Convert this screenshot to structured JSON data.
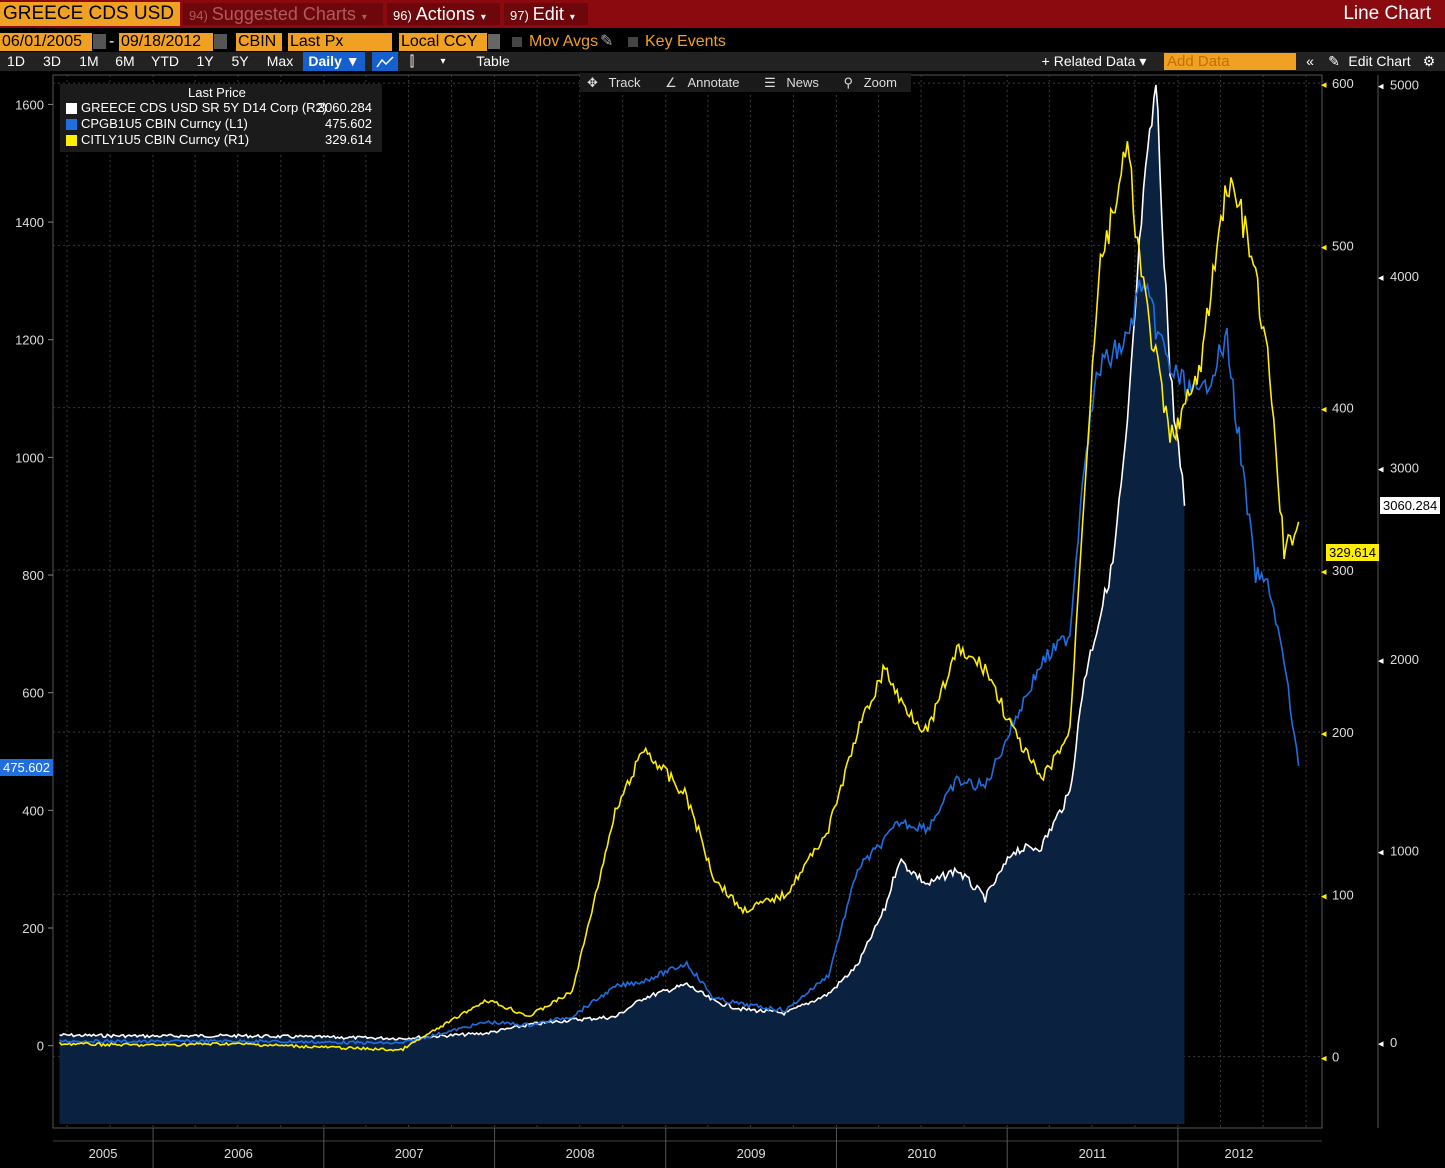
{
  "header": {
    "security": "GREECE CDS USD SR",
    "menus": [
      {
        "num": "94)",
        "label": "Suggested Charts"
      },
      {
        "num": "96)",
        "label": "Actions"
      },
      {
        "num": "97)",
        "label": "Edit"
      }
    ],
    "chart_kind": "Line Chart"
  },
  "controls": {
    "start_date": "06/01/2005",
    "end_date": "09/18/2012",
    "source": "CBIN",
    "field": "Last Px",
    "currency": "Local CCY",
    "mov_avgs": "Mov Avgs",
    "key_events": "Key Events"
  },
  "ranges": {
    "buttons": [
      "1D",
      "3D",
      "1M",
      "6M",
      "YTD",
      "1Y",
      "5Y",
      "Max"
    ],
    "frequency": "Daily ▼",
    "table": "Table",
    "related": "+ Related Data ▾",
    "add_data_placeholder": "Add Data",
    "edit_chart": "Edit Chart"
  },
  "toolbar": {
    "track": "Track",
    "annotate": "Annotate",
    "news": "News",
    "zoom": "Zoom"
  },
  "legend": {
    "title": "Last Price",
    "items": [
      {
        "label": "GREECE CDS USD SR 5Y D14 Corp  (R2)",
        "value": "3060.284",
        "color": "#ffffff"
      },
      {
        "label": "CPGB1U5 CBIN Curncy  (L1)",
        "value": "475.602",
        "color": "#1f6fe0"
      },
      {
        "label": "CITLY1U5 CBIN Curncy  (R1)",
        "value": "329.614",
        "color": "#ffee00"
      }
    ]
  },
  "chart_data": {
    "type": "line",
    "x_start": "2005-06-01",
    "x_end": "2012-09-18",
    "x_ticks": [
      "2005",
      "2006",
      "2007",
      "2008",
      "2009",
      "2010",
      "2011",
      "2012"
    ],
    "axes": {
      "L1": {
        "ticks": [
          "0",
          "200",
          "400",
          "600",
          "800",
          "1000",
          "1200",
          "1400",
          "1600"
        ],
        "range": [
          -140,
          1650
        ]
      },
      "R1": {
        "ticks": [
          "0",
          "100",
          "200",
          "300",
          "400",
          "500",
          "600"
        ],
        "range": [
          -44,
          605
        ]
      },
      "R2": {
        "ticks": [
          "0",
          "1000",
          "2000",
          "3000",
          "4000",
          "5000"
        ],
        "range": [
          -450,
          5050
        ]
      }
    },
    "last_values": {
      "L1": "475.602",
      "R1": "329.614",
      "R2": "3060.284"
    },
    "series": [
      {
        "name": "GREECE CDS USD SR 5Y D14 Corp",
        "axis": "R2",
        "color": "#ffffff",
        "fill": "#0b2140",
        "points": [
          [
            "2005-06",
            35
          ],
          [
            "2005-12",
            30
          ],
          [
            "2006-06",
            32
          ],
          [
            "2006-12",
            25
          ],
          [
            "2007-06",
            18
          ],
          [
            "2007-12",
            45
          ],
          [
            "2008-03",
            90
          ],
          [
            "2008-06",
            115
          ],
          [
            "2008-09",
            130
          ],
          [
            "2008-11",
            230
          ],
          [
            "2009-02",
            300
          ],
          [
            "2009-04",
            210
          ],
          [
            "2009-06",
            170
          ],
          [
            "2009-09",
            150
          ],
          [
            "2009-12",
            250
          ],
          [
            "2010-02",
            400
          ],
          [
            "2010-04",
            700
          ],
          [
            "2010-05",
            950
          ],
          [
            "2010-07",
            820
          ],
          [
            "2010-09",
            900
          ],
          [
            "2010-11",
            750
          ],
          [
            "2011-01",
            1000
          ],
          [
            "2011-03",
            1020
          ],
          [
            "2011-05",
            1300
          ],
          [
            "2011-06",
            1900
          ],
          [
            "2011-08",
            2500
          ],
          [
            "2011-09",
            3200
          ],
          [
            "2011-10",
            4300
          ],
          [
            "2011-11",
            5000
          ],
          [
            "2011-12",
            3500
          ],
          [
            "2012-01",
            2800
          ]
        ]
      },
      {
        "name": "CPGB1U5 CBIN Curncy",
        "axis": "L1",
        "color": "#1f6fe0",
        "points": [
          [
            "2005-06",
            8
          ],
          [
            "2005-12",
            7
          ],
          [
            "2006-06",
            8
          ],
          [
            "2006-12",
            6
          ],
          [
            "2007-06",
            4
          ],
          [
            "2007-12",
            40
          ],
          [
            "2008-03",
            35
          ],
          [
            "2008-06",
            50
          ],
          [
            "2008-09",
            100
          ],
          [
            "2008-11",
            110
          ],
          [
            "2009-02",
            140
          ],
          [
            "2009-04",
            80
          ],
          [
            "2009-06",
            70
          ],
          [
            "2009-09",
            60
          ],
          [
            "2009-12",
            120
          ],
          [
            "2010-02",
            300
          ],
          [
            "2010-04",
            350
          ],
          [
            "2010-05",
            380
          ],
          [
            "2010-07",
            370
          ],
          [
            "2010-09",
            450
          ],
          [
            "2010-11",
            440
          ],
          [
            "2011-01",
            550
          ],
          [
            "2011-03",
            650
          ],
          [
            "2011-05",
            700
          ],
          [
            "2011-06",
            1000
          ],
          [
            "2011-07",
            1150
          ],
          [
            "2011-09",
            1200
          ],
          [
            "2011-10",
            1300
          ],
          [
            "2011-12",
            1150
          ],
          [
            "2012-02",
            1100
          ],
          [
            "2012-04",
            1200
          ],
          [
            "2012-05",
            1000
          ],
          [
            "2012-06",
            800
          ],
          [
            "2012-07",
            780
          ],
          [
            "2012-08",
            650
          ],
          [
            "2012-09",
            475.602
          ]
        ]
      },
      {
        "name": "CITLY1U5 CBIN Curncy",
        "axis": "R1",
        "color": "#ffee00",
        "points": [
          [
            "2005-06",
            8
          ],
          [
            "2005-12",
            7
          ],
          [
            "2006-06",
            8
          ],
          [
            "2006-12",
            6
          ],
          [
            "2007-06",
            4
          ],
          [
            "2007-12",
            35
          ],
          [
            "2008-03",
            25
          ],
          [
            "2008-06",
            40
          ],
          [
            "2008-09",
            150
          ],
          [
            "2008-11",
            190
          ],
          [
            "2009-02",
            160
          ],
          [
            "2009-04",
            110
          ],
          [
            "2009-06",
            90
          ],
          [
            "2009-09",
            100
          ],
          [
            "2009-12",
            140
          ],
          [
            "2010-02",
            200
          ],
          [
            "2010-04",
            240
          ],
          [
            "2010-05",
            220
          ],
          [
            "2010-07",
            200
          ],
          [
            "2010-09",
            250
          ],
          [
            "2010-11",
            240
          ],
          [
            "2011-01",
            200
          ],
          [
            "2011-03",
            170
          ],
          [
            "2011-05",
            200
          ],
          [
            "2011-06",
            350
          ],
          [
            "2011-07",
            480
          ],
          [
            "2011-09",
            560
          ],
          [
            "2011-10",
            480
          ],
          [
            "2011-12",
            380
          ],
          [
            "2012-02",
            420
          ],
          [
            "2012-04",
            540
          ],
          [
            "2012-05",
            520
          ],
          [
            "2012-06",
            480
          ],
          [
            "2012-07",
            420
          ],
          [
            "2012-08",
            310
          ],
          [
            "2012-09",
            329.614
          ]
        ]
      }
    ]
  }
}
